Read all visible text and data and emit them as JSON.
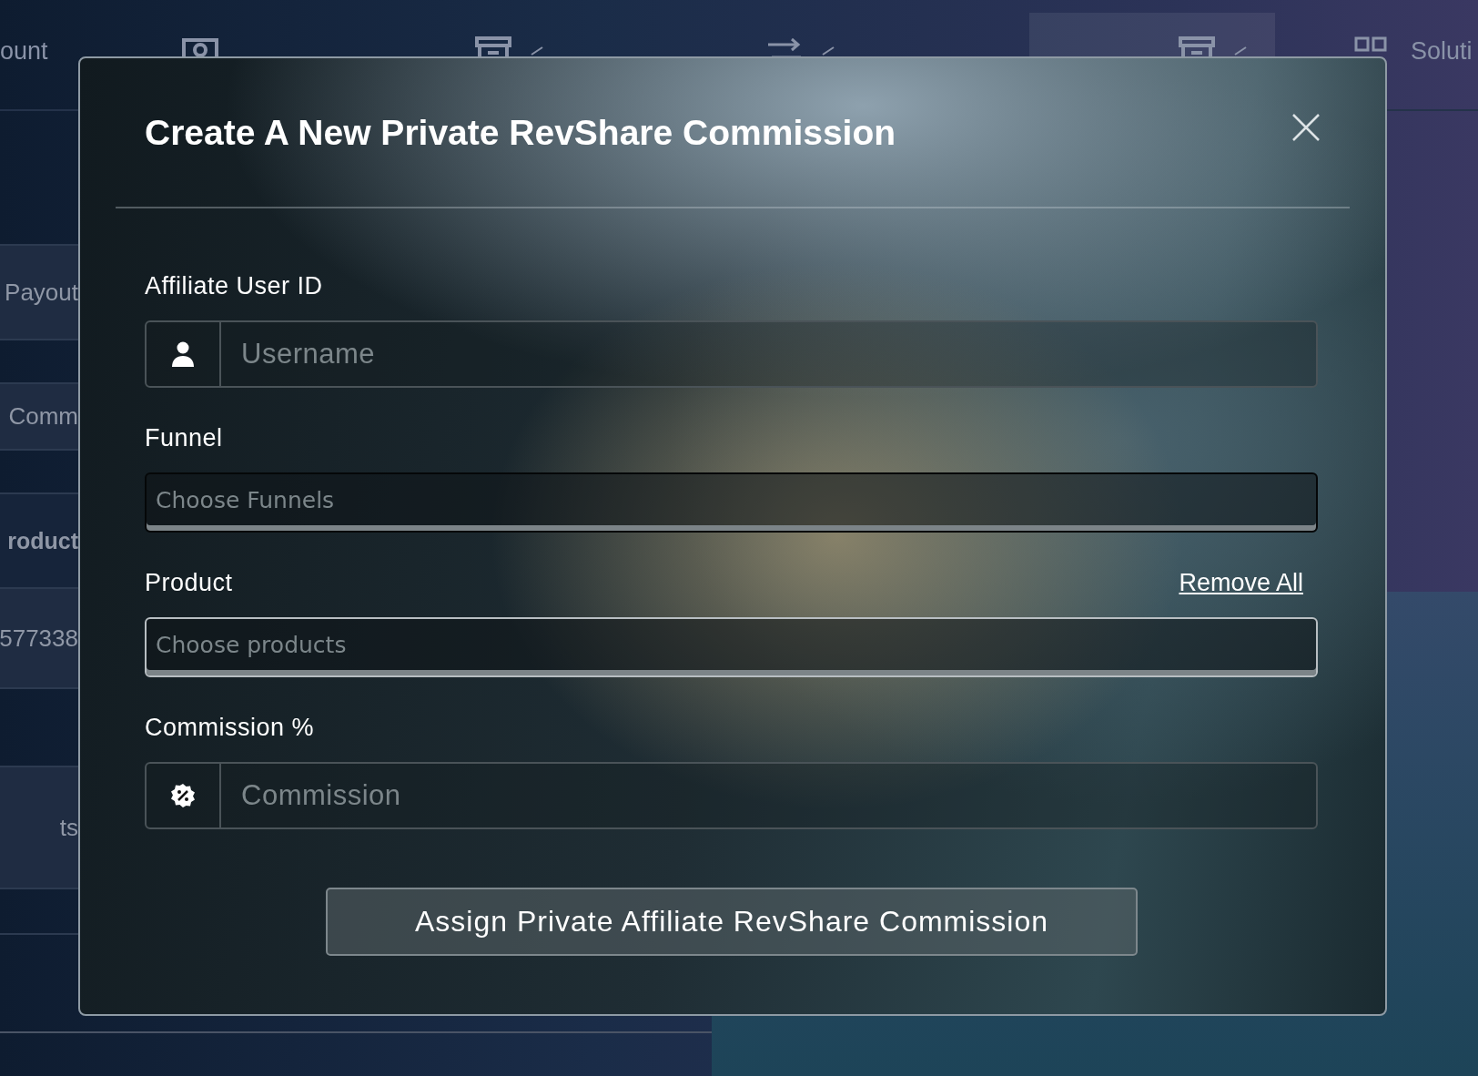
{
  "nav": {
    "items": [
      {
        "label": "ount",
        "dropdown": false,
        "selected": false
      },
      {
        "dropdown": false,
        "selected": false
      },
      {
        "dropdown": true,
        "selected": false
      },
      {
        "dropdown": true,
        "selected": false
      },
      {
        "dropdown": true,
        "selected": true
      },
      {
        "label": "Soluti",
        "dropdown": false,
        "selected": false
      }
    ]
  },
  "side_rows": [
    {
      "text": "Payout",
      "kind": "label"
    },
    {
      "text": "Comm",
      "kind": "label"
    },
    {
      "text": "roduct",
      "kind": "header"
    },
    {
      "text": "577338",
      "kind": "value"
    },
    {
      "text": "ts",
      "kind": "label"
    }
  ],
  "modal": {
    "title": "Create A New Private RevShare Commission",
    "fields": [
      {
        "label": "Affiliate User ID",
        "kind": "addon",
        "placeholder": "Username"
      },
      {
        "label": "Funnel",
        "kind": "select",
        "placeholder": "Choose Funnels",
        "focused": false
      },
      {
        "label": "Product",
        "kind": "select",
        "placeholder": "Choose products",
        "focused": true,
        "action": "Remove All"
      },
      {
        "label": "Commission %",
        "kind": "addon",
        "placeholder": "Commission"
      }
    ],
    "submit": "Assign Private Affiliate RevShare Commission"
  }
}
